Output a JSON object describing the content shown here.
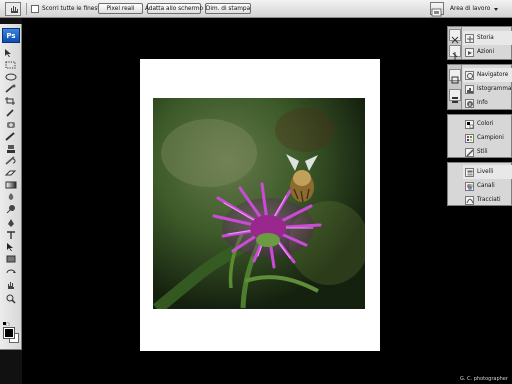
{
  "options_bar": {
    "checkbox_label": "Scorri tutte le finestre",
    "button_actual_pixels": "Pixel reali",
    "button_fit_screen": "Adatta allo schermo",
    "button_print_size": "Dim. di stampa",
    "workspace_label": "Area di lavoro"
  },
  "toolbox": {
    "logo_text": "Ps",
    "tools": [
      "move-icon",
      "marquee-icon",
      "lasso-icon",
      "quick-selection-icon",
      "crop-icon",
      "eyedropper-icon",
      "healing-brush-icon",
      "brush-icon",
      "clone-stamp-icon",
      "history-brush-icon",
      "eraser-icon",
      "gradient-icon",
      "blur-icon",
      "dodge-icon",
      "pen-icon",
      "type-icon",
      "path-selection-icon",
      "shape-icon",
      "3d-rotate-icon",
      "hand-icon",
      "zoom-icon"
    ]
  },
  "panels": {
    "group1": [
      {
        "label": "Storia",
        "icon": "history-icon"
      },
      {
        "label": "Azioni",
        "icon": "actions-icon"
      }
    ],
    "group2": [
      {
        "label": "Navigatore",
        "icon": "navigator-icon"
      },
      {
        "label": "Istogramma",
        "icon": "histogram-icon"
      },
      {
        "label": "Info",
        "icon": "info-icon"
      }
    ],
    "group3": [
      {
        "label": "Colori",
        "icon": "color-icon"
      },
      {
        "label": "Campioni",
        "icon": "swatches-icon"
      },
      {
        "label": "Stili",
        "icon": "styles-icon"
      }
    ],
    "group4": [
      {
        "label": "Livelli",
        "icon": "layers-icon"
      },
      {
        "label": "Canali",
        "icon": "channels-icon"
      },
      {
        "label": "Tracciati",
        "icon": "paths-icon"
      }
    ]
  },
  "document": {
    "photo_subject": "bee-on-purple-knapweed-flower-photo"
  },
  "footer": {
    "credit": "G. C. photographer"
  },
  "colors": {
    "accent_blue": "#1b63c6",
    "panel_gray": "#d7d7d7",
    "canvas_black": "#000000",
    "flower_purple": "#b43ac8",
    "leaf_green": "#3f6f2b"
  }
}
